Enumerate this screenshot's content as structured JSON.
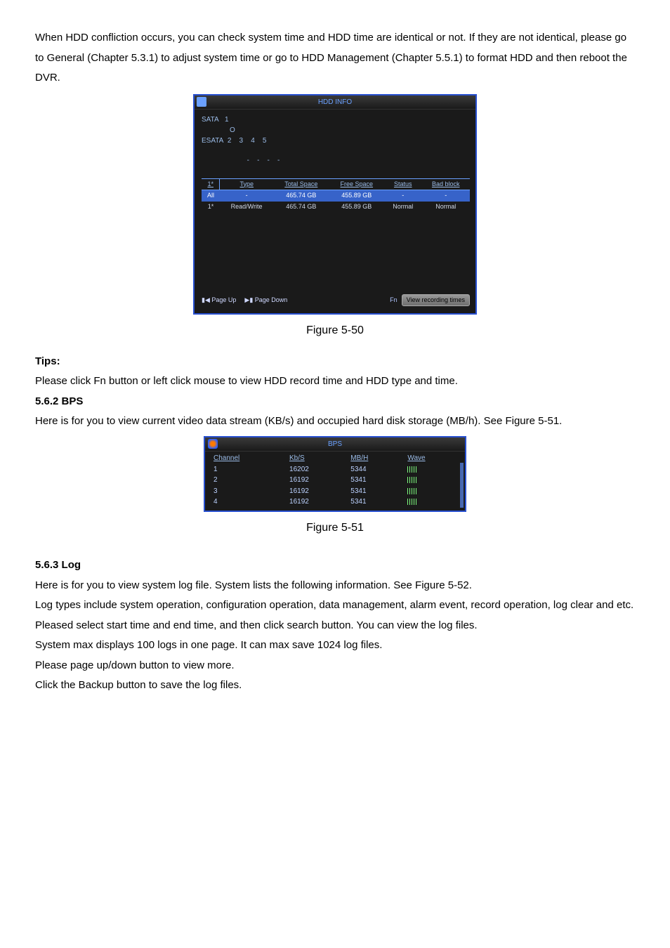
{
  "intro_para": "When HDD confliction occurs, you can check system time and HDD time are identical or not. If they are not identical, please go to General (Chapter 5.3.1) to adjust system time or go to HDD Management (Chapter 5.5.1) to format HDD and then reboot the DVR.",
  "hdd": {
    "title": "HDD INFO",
    "sata_label": "SATA",
    "sata_slots": "1",
    "sata_status": "O",
    "esata_label": "ESATA",
    "esata_slots": "2    3    4    5",
    "esata_status": "-    -    -    -",
    "cols": {
      "c1": "1*",
      "c2": "Type",
      "c3": "Total Space",
      "c4": "Free Space",
      "c5": "Status",
      "c6": "Bad block"
    },
    "rows": [
      {
        "c1": "All",
        "c2": "-",
        "c3": "465.74 GB",
        "c4": "455.89 GB",
        "c5": "-",
        "c6": "-"
      },
      {
        "c1": "1*",
        "c2": "Read/Write",
        "c3": "465.74 GB",
        "c4": "455.89 GB",
        "c5": "Normal",
        "c6": "Normal"
      }
    ],
    "page_up": "Page Up",
    "page_down": "Page Down",
    "fn": "Fn",
    "view_btn": "View recording times"
  },
  "fig50": "Figure 5-50",
  "tips_heading": "Tips:",
  "tips_body": "Please click Fn button or left click mouse to view HDD record time and HDD type and time.",
  "section_bps": "5.6.2  BPS",
  "bps_para": "Here is for you to view current video data stream (KB/s) and occupied hard disk storage (MB/h). See Figure 5-51.",
  "bps": {
    "title": "BPS",
    "cols": {
      "ch": "Channel",
      "kbs": "Kb/S",
      "mbh": "MB/H",
      "wave": "Wave"
    },
    "rows": [
      {
        "ch": "1",
        "kbs": "16202",
        "mbh": "5344"
      },
      {
        "ch": "2",
        "kbs": "16192",
        "mbh": "5341"
      },
      {
        "ch": "3",
        "kbs": "16192",
        "mbh": "5341"
      },
      {
        "ch": "4",
        "kbs": "16192",
        "mbh": "5341"
      }
    ]
  },
  "fig51": "Figure 5-51",
  "section_log": "5.6.3  Log",
  "log_p1": "Here is for you to view system log file. System lists the following information. See Figure 5-52.",
  "log_p2": "Log types include system operation, configuration operation, data management, alarm event, record operation, log clear and etc.",
  "log_p3": "Pleased select start time and end time, and then click search button. You can view the log files.",
  "log_p4": "System max displays 100 logs in one page. It can max save 1024 log files.",
  "log_p5": "Please page up/down button to view more.",
  "log_p6": "Click the Backup button to save the log files."
}
